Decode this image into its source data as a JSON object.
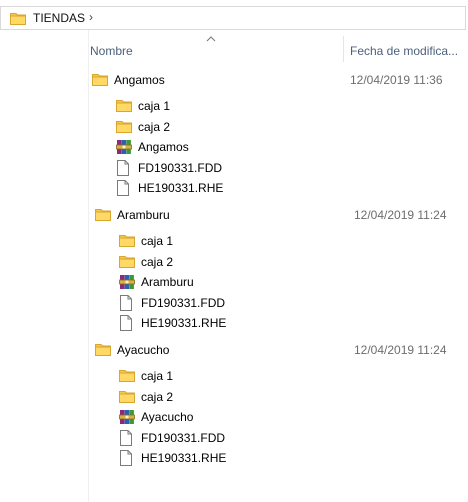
{
  "address_bar": {
    "path": "TIENDAS",
    "separator": "›"
  },
  "columns": {
    "name": "Nombre",
    "date": "Fecha de modifica..."
  },
  "colors": {
    "folder": "#f5c84c",
    "header_text": "#4c607a",
    "date_text": "#6d6d6d"
  },
  "groups": [
    {
      "name": "Angamos",
      "date": "12/04/2019 11:36",
      "children": [
        {
          "name": "caja 1",
          "icon": "folder-icon"
        },
        {
          "name": "caja 2",
          "icon": "folder-icon"
        },
        {
          "name": "Angamos",
          "icon": "winrar-archive-icon"
        },
        {
          "name": "FD190331.FDD",
          "icon": "file-icon"
        },
        {
          "name": "HE190331.RHE",
          "icon": "file-icon"
        }
      ]
    },
    {
      "name": "Aramburu",
      "date": "12/04/2019 11:24",
      "children": [
        {
          "name": "caja 1",
          "icon": "folder-icon"
        },
        {
          "name": "caja 2",
          "icon": "folder-icon"
        },
        {
          "name": "Aramburu",
          "icon": "winrar-archive-icon"
        },
        {
          "name": "FD190331.FDD",
          "icon": "file-icon"
        },
        {
          "name": "HE190331.RHE",
          "icon": "file-icon"
        }
      ]
    },
    {
      "name": "Ayacucho",
      "date": "12/04/2019 11:24",
      "children": [
        {
          "name": "caja 1",
          "icon": "folder-icon"
        },
        {
          "name": "caja 2",
          "icon": "folder-icon"
        },
        {
          "name": "Ayacucho",
          "icon": "winrar-archive-icon"
        },
        {
          "name": "FD190331.FDD",
          "icon": "file-icon"
        },
        {
          "name": "HE190331.RHE",
          "icon": "file-icon"
        }
      ]
    }
  ]
}
